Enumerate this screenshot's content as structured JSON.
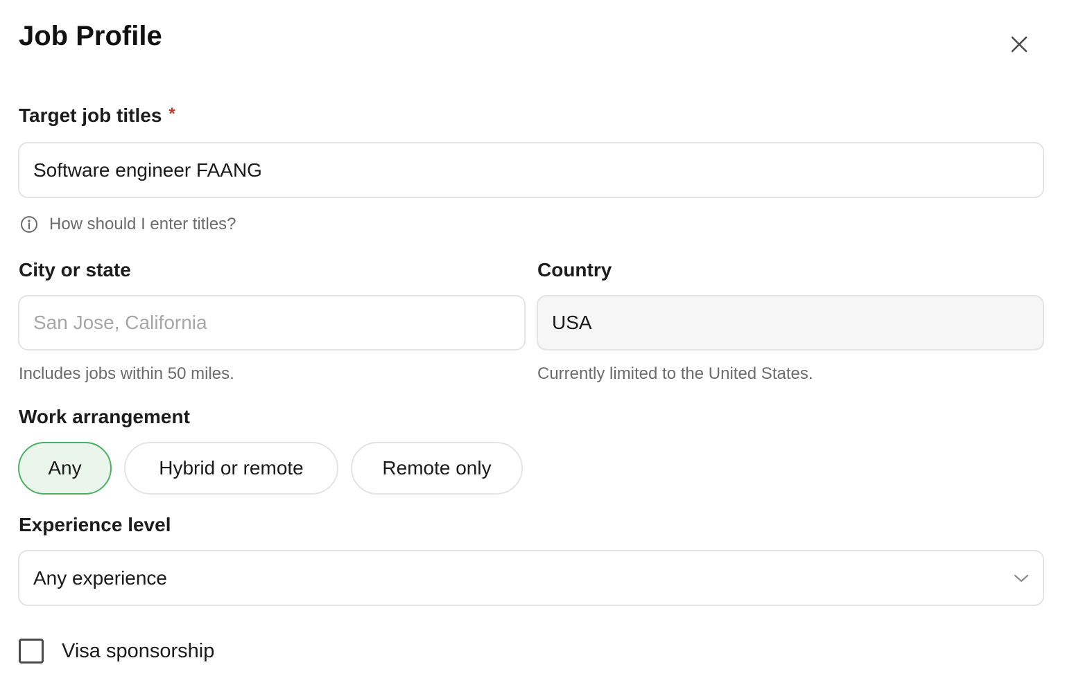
{
  "dialog": {
    "title": "Job Profile",
    "close_icon": "close-icon"
  },
  "job_titles": {
    "label": "Target job titles",
    "required_marker": "*",
    "value": "Software engineer FAANG",
    "help_icon": "info-icon",
    "help_text": "How should I enter titles?"
  },
  "city": {
    "label": "City or state",
    "value": "",
    "placeholder": "San Jose, California",
    "hint": "Includes jobs within 50 miles."
  },
  "country": {
    "label": "Country",
    "value": "USA",
    "hint": "Currently limited to the United States."
  },
  "work_arrangement": {
    "label": "Work arrangement",
    "options": [
      {
        "label": "Any",
        "selected": true
      },
      {
        "label": "Hybrid or remote",
        "selected": false
      },
      {
        "label": "Remote only",
        "selected": false
      }
    ],
    "selected_color": "#eaf6ec",
    "selected_border": "#4caf63"
  },
  "experience": {
    "label": "Experience level",
    "value": "Any experience",
    "chevron_icon": "chevron-down-icon"
  },
  "visa": {
    "label": "Visa sponsorship",
    "checked": false
  },
  "colors": {
    "required": "#c0392b",
    "hint": "#6b6b6b",
    "border": "#e4e4e4"
  }
}
